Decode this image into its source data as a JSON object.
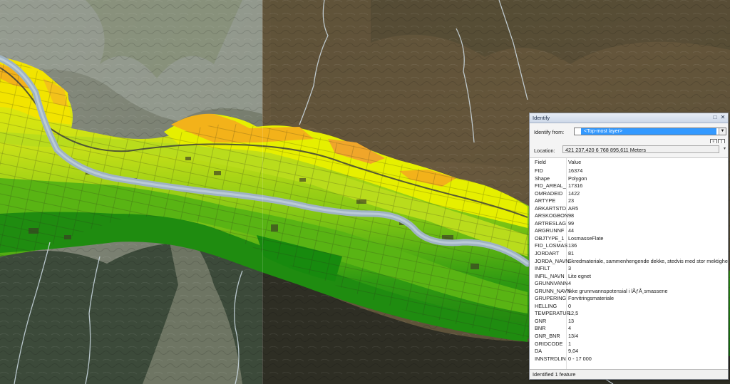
{
  "identify": {
    "title": "Identify",
    "identify_from_label": "Identify from:",
    "identify_from_value": "<Top-most layer>",
    "location_label": "Location:",
    "location_value": "421 237,420  6 768 895,611 Meters",
    "columns": {
      "field": "Field",
      "value": "Value"
    },
    "rows": [
      {
        "field": "FID",
        "value": "16374"
      },
      {
        "field": "Shape",
        "value": "Polygon"
      },
      {
        "field": "FID_AREAL_",
        "value": "17316"
      },
      {
        "field": "OMRADEID",
        "value": "1422"
      },
      {
        "field": "ARTYPE",
        "value": "23"
      },
      {
        "field": "ARKARTSTD",
        "value": "AR5"
      },
      {
        "field": "ARSKOGBON",
        "value": "98"
      },
      {
        "field": "ARTRESLAG",
        "value": "99"
      },
      {
        "field": "ARGRUNNF",
        "value": "44"
      },
      {
        "field": "OBJTYPE_1",
        "value": "LosmasseFlate"
      },
      {
        "field": "FID_LOSMAS",
        "value": "136"
      },
      {
        "field": "JORDART",
        "value": "81"
      },
      {
        "field": "JORDA_NAVN",
        "value": "Skredmateriale, sammenhengende dekke, stedvis med stor mektighet"
      },
      {
        "field": "INFILT",
        "value": "3"
      },
      {
        "field": "INFIL_NAVN",
        "value": "Lite egnet"
      },
      {
        "field": "GRUNNVANN",
        "value": "4"
      },
      {
        "field": "GRUNN_NAVN",
        "value": "Ikke grunnvannspotensial i lÃƒÂ¸smassene"
      },
      {
        "field": "GRUPERING",
        "value": "Forvitringsmateriale"
      },
      {
        "field": "HELLING",
        "value": "0"
      },
      {
        "field": "TEMPERATUR",
        "value": "12,5"
      },
      {
        "field": "GNR",
        "value": "13"
      },
      {
        "field": "BNR",
        "value": "4"
      },
      {
        "field": "GNR_BNR",
        "value": "13/4"
      },
      {
        "field": "GRIDCODE",
        "value": "1"
      },
      {
        "field": "DA",
        "value": "9,04"
      },
      {
        "field": "INNSTRDLIN",
        "value": "0 - 17 000"
      }
    ],
    "status": "Identified 1 feature",
    "icons": [
      "restore-icon",
      "close-icon",
      "dropdown-arrow-icon",
      "expand-icon",
      "collapse-icon"
    ]
  }
}
